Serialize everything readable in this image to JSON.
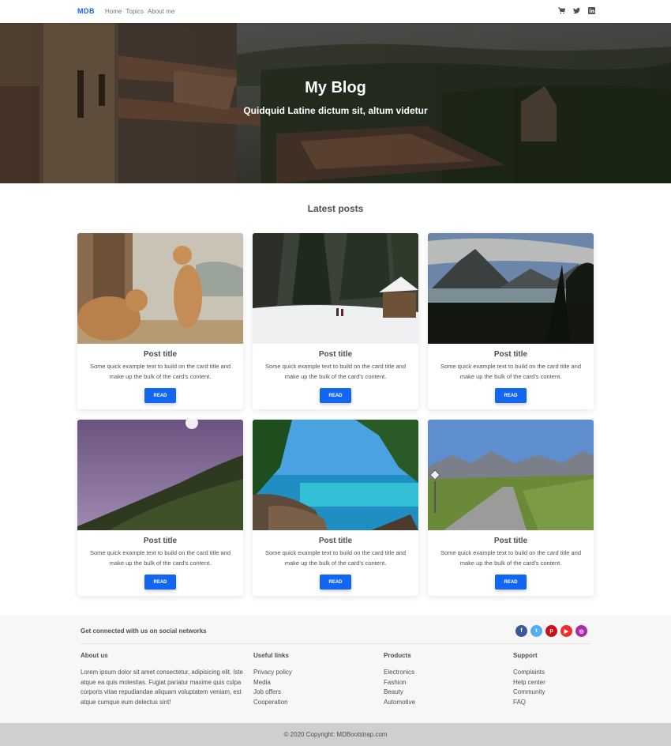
{
  "navbar": {
    "brand": "MDB",
    "links": [
      "Home",
      "Topics",
      "About me"
    ],
    "icons": [
      "cart-icon",
      "twitter-icon",
      "linkedin-icon"
    ]
  },
  "hero": {
    "title": "My Blog",
    "subtitle": "Quidquid Latine dictum sit, altum videtur"
  },
  "posts": {
    "heading": "Latest posts",
    "cards": [
      {
        "image": "lionesses-image",
        "title": "Post title",
        "text": "Some quick example text to build on the card title and make up the bulk of the card's content.",
        "button": "READ"
      },
      {
        "image": "snowy-forest-image",
        "title": "Post title",
        "text": "Some quick example text to build on the card title and make up the bulk of the card's content.",
        "button": "READ"
      },
      {
        "image": "mountain-lake-image",
        "title": "Post title",
        "text": "Some quick example text to build on the card title and make up the bulk of the card's content.",
        "button": "READ"
      },
      {
        "image": "night-hill-image",
        "title": "Post title",
        "text": "Some quick example text to build on the card title and make up the bulk of the card's content.",
        "button": "READ"
      },
      {
        "image": "tropical-beach-image",
        "title": "Post title",
        "text": "Some quick example text to build on the card title and make up the bulk of the card's content.",
        "button": "READ"
      },
      {
        "image": "mountain-road-image",
        "title": "Post title",
        "text": "Some quick example text to build on the card title and make up the bulk of the card's content.",
        "button": "READ"
      }
    ]
  },
  "footer": {
    "social_text": "Get connected with us on social networks",
    "socials": [
      {
        "icon": "facebook-icon",
        "glyph": "f",
        "color": "#3b5998"
      },
      {
        "icon": "twitter-icon",
        "glyph": "t",
        "color": "#55acee"
      },
      {
        "icon": "pinterest-icon",
        "glyph": "p",
        "color": "#c61118"
      },
      {
        "icon": "youtube-icon",
        "glyph": "▶",
        "color": "#ed302f"
      },
      {
        "icon": "instagram-icon",
        "glyph": "◎",
        "color": "#ac2bac"
      }
    ],
    "about": {
      "heading": "About us",
      "text": "Lorem ipsum dolor sit amet consectetur, adipisicing elit. Iste atque ea quis molestias. Fugiat pariatur maxime quis culpa corporis vitae repudiandae aliquam voluptatem veniam, est atque cumque eum delectus sint!"
    },
    "useful": {
      "heading": "Useful links",
      "items": [
        "Privacy policy",
        "Media",
        "Job offers",
        "Cooperation"
      ]
    },
    "products": {
      "heading": "Products",
      "items": [
        "Electronics",
        "Fashion",
        "Beauty",
        "Automotive"
      ]
    },
    "support": {
      "heading": "Support",
      "items": [
        "Complaints",
        "Help center",
        "Community",
        "FAQ"
      ]
    },
    "copyright_prefix": "© 2020 Copyright:",
    "copyright_link": "MDBootstrap.com"
  },
  "colors": {
    "primary": "#1266f1",
    "footer_bg": "#f7f7f7",
    "copyright_bg": "#cfcfcf"
  }
}
